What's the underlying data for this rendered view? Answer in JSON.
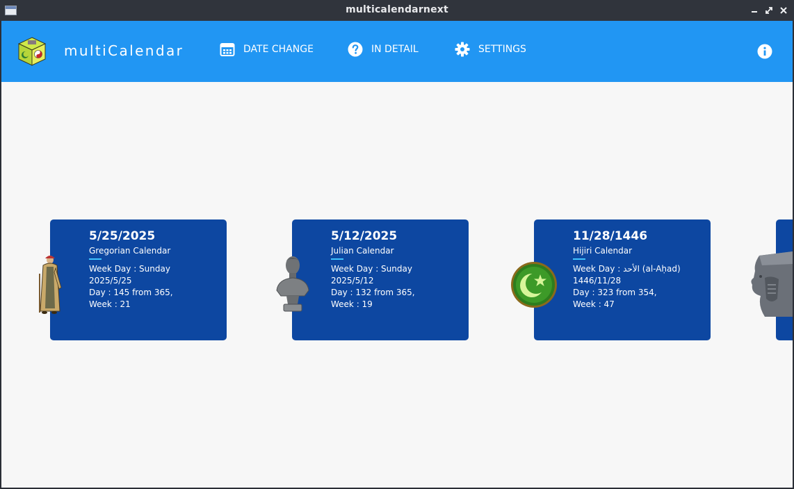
{
  "window": {
    "title": "multicalendarnext",
    "min_glyph": "▁",
    "max_glyph": "⤢",
    "close_glyph": "✕"
  },
  "app": {
    "brand": "multiCalendar",
    "nav": [
      {
        "label": "DATE CHANGE",
        "icon": "calendar-icon"
      },
      {
        "label": "IN DETAIL",
        "icon": "help-circle-icon"
      },
      {
        "label": "SETTINGS",
        "icon": "gear-icon"
      }
    ],
    "info_icon": "info-icon"
  },
  "colors": {
    "appbar": "#2196f3",
    "card": "#0d47a1",
    "accent": "#40c4ff",
    "background": "#f7f7f7"
  },
  "cards": [
    {
      "date": "5/25/2025",
      "calendar": "Gregorian Calendar",
      "weekday": "Week Day :  Sunday",
      "iso": "2025/5/25",
      "day": "Day :  145 from  365,",
      "week": "Week :  21",
      "figure": "pope-figure"
    },
    {
      "date": "5/12/2025",
      "calendar": "Julian Calendar",
      "weekday": "Week Day :  Sunday",
      "iso": "2025/5/12",
      "day": "Day :  132 from  365,",
      "week": "Week :  19",
      "figure": "caesar-bust"
    },
    {
      "date": "11/28/1446",
      "calendar": "Hijiri Calendar",
      "weekday": "Week Day :  الأحد (al-Aḥad)",
      "iso": "1446/11/28",
      "day": "Day :  323 from  354,",
      "week": "Week :  47",
      "figure": "crescent-emblem"
    }
  ]
}
